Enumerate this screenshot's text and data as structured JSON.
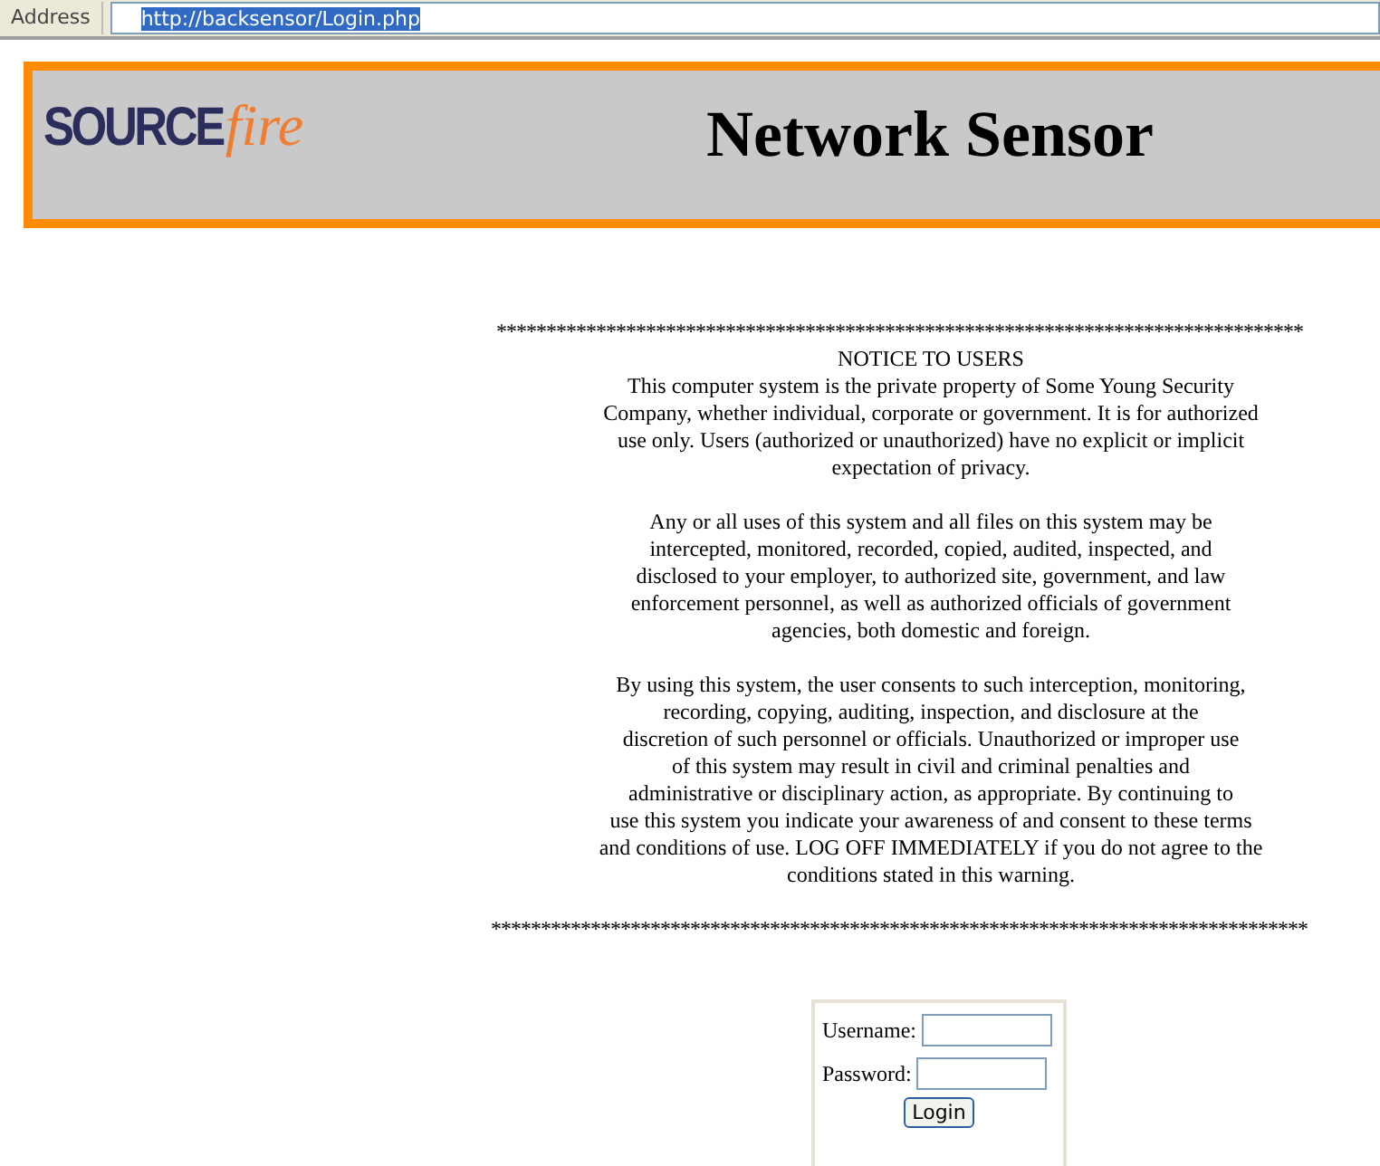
{
  "address_bar": {
    "label": "Address",
    "url": "http://backsensor/Login.php",
    "url_selected": true
  },
  "header": {
    "logo": {
      "part_1": "SOURCE",
      "part_2": "fire"
    },
    "title": "Network Sensor"
  },
  "notice": {
    "rule_top": "*********************************************************************************",
    "heading": "NOTICE TO USERS",
    "paragraphs": [
      "This computer system is the private property of Some Young Security\nCompany, whether individual, corporate or government. It is for authorized\nuse only. Users (authorized or unauthorized) have no explicit or implicit\nexpectation of privacy.",
      "Any or all uses of this system and all files on this system may be\nintercepted, monitored, recorded, copied, audited, inspected, and\ndisclosed to your employer, to authorized site, government, and law\nenforcement personnel, as well as authorized officials of government\nagencies, both domestic and foreign.",
      "By using this system, the user consents to such interception, monitoring,\nrecording, copying, auditing, inspection, and disclosure at the\ndiscretion of such personnel or officials. Unauthorized or improper use\nof this system may result in civil and criminal penalties and\nadministrative or disciplinary action, as appropriate. By continuing to\nuse this system you indicate your awareness of and consent to these terms\nand conditions of use. LOG OFF IMMEDIATELY if you do not agree to the\nconditions stated in this warning."
    ],
    "rule_bottom": "**********************************************************************************"
  },
  "login": {
    "fields": [
      {
        "label": "Username:"
      },
      {
        "label": "Password:"
      }
    ],
    "button": "Login"
  }
}
